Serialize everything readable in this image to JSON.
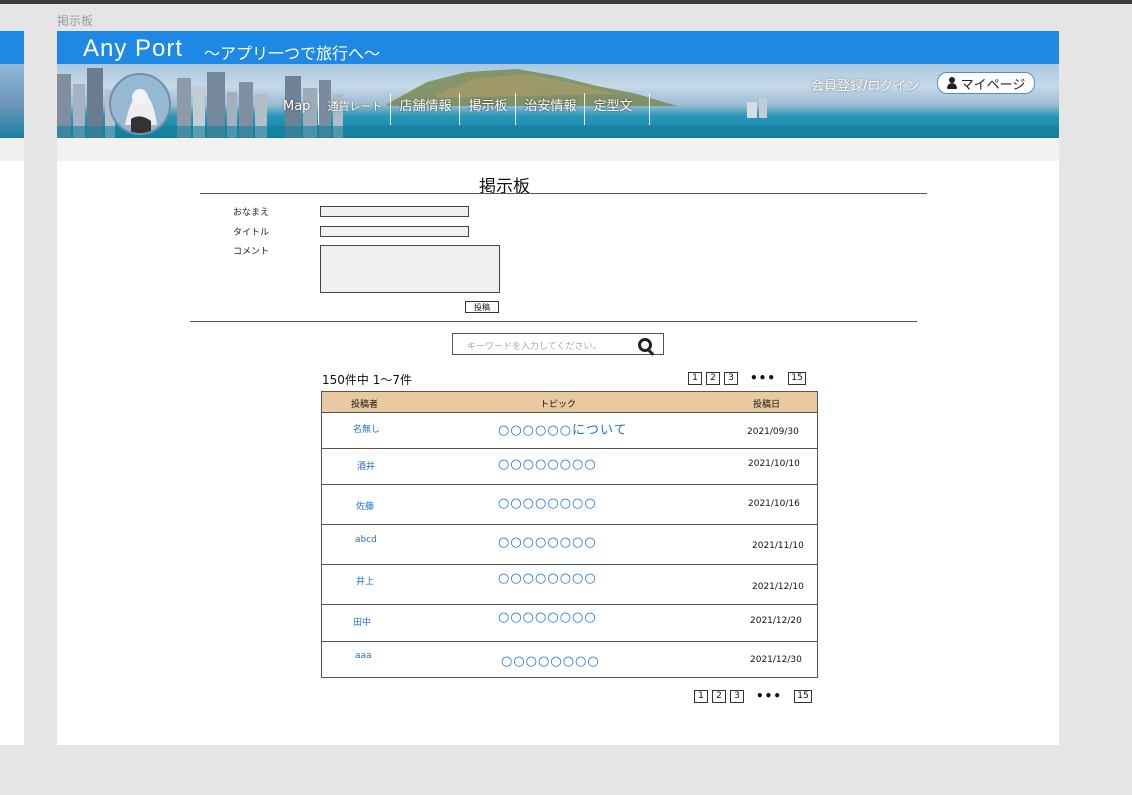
{
  "frame_label": "掲示板",
  "app": {
    "name": "Any Port",
    "tagline": "〜アプリ一つで旅行へ〜"
  },
  "nav": [
    "Map",
    "通貨レート",
    "店舗情報",
    "掲示板",
    "治安情報",
    "定型文"
  ],
  "account": {
    "login": "会員登録/ログイン",
    "mypage": "マイページ",
    "mypage_icon": "person-icon"
  },
  "board": {
    "title": "掲示板",
    "form": {
      "name_label": "おなまえ",
      "title_label": "タイトル",
      "comment_label": "コメント",
      "submit": "投稿"
    },
    "search": {
      "placeholder": "キーワードを入力してください。",
      "icon": "search-icon"
    },
    "count": "150件中 1〜7件",
    "pager": [
      "1",
      "2",
      "3",
      "•••",
      "15"
    ],
    "columns": [
      "投稿者",
      "トピック",
      "投稿日"
    ],
    "rows": [
      {
        "author": "名無し",
        "topic": "○○○○○○について",
        "date": "2021/09/30"
      },
      {
        "author": "酒井",
        "topic": "○○○○○○○○",
        "date": "2021/10/10"
      },
      {
        "author": "佐藤",
        "topic": "○○○○○○○○",
        "date": "2021/10/16"
      },
      {
        "author": "abcd",
        "topic": "○○○○○○○○",
        "date": "2021/11/10"
      },
      {
        "author": "井上",
        "topic": "○○○○○○○○",
        "date": "2021/12/10"
      },
      {
        "author": "田中",
        "topic": "○○○○○○○○",
        "date": "2021/12/20"
      },
      {
        "author": "aaa",
        "topic": "○○○○○○○○",
        "date": "2021/12/30"
      }
    ]
  },
  "colors": {
    "header_blue": "#1e88e5",
    "table_head": "#e8c9a0",
    "link_blue": "#1e6fd9"
  }
}
